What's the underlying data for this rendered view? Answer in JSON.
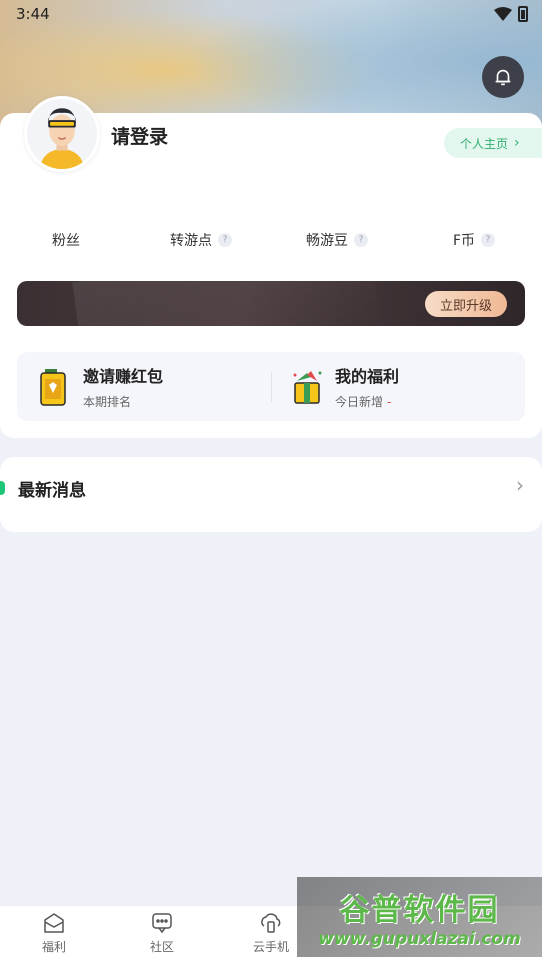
{
  "status_bar": {
    "time": "3:44"
  },
  "profile": {
    "login_text": "请登录",
    "homepage_label": "个人主页",
    "homepage_chevron": "›"
  },
  "stats": [
    {
      "label": "粉丝",
      "has_help": false
    },
    {
      "label": "转游点",
      "has_help": true
    },
    {
      "label": "畅游豆",
      "has_help": true
    },
    {
      "label": "F币",
      "has_help": true
    }
  ],
  "help_glyph": "?",
  "upgrade": {
    "button_label": "立即升级"
  },
  "welfare": {
    "invite": {
      "title": "邀请赚红包",
      "subtitle": "本期排名"
    },
    "mine": {
      "title": "我的福利",
      "subtitle": "今日新增",
      "value": "-"
    }
  },
  "news": {
    "title": "最新消息",
    "chevron": "›"
  },
  "tabs": [
    {
      "label": "福利",
      "icon": "gift-mail-icon"
    },
    {
      "label": "社区",
      "icon": "chat-icon"
    },
    {
      "label": "云手机",
      "icon": "cloud-phone-icon"
    }
  ],
  "watermark": {
    "title": "谷普软件园",
    "url": "www.gupuxlazai.com"
  },
  "colors": {
    "accent": "#1cc77a",
    "homepage_text": "#2fae6f",
    "upgrade_bg": "#3a2f32"
  }
}
